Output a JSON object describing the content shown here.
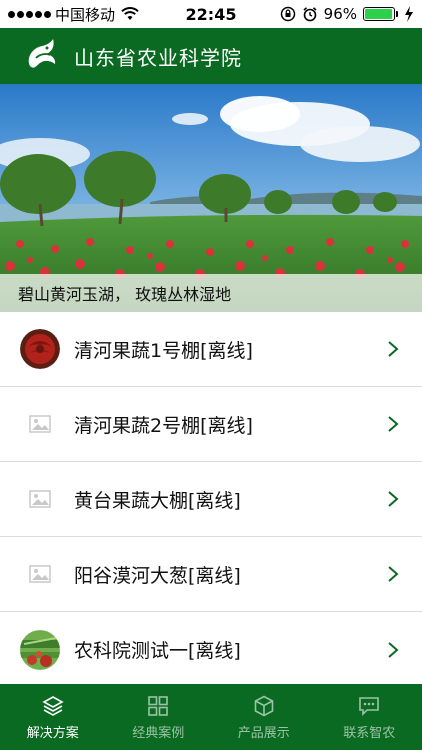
{
  "status_bar": {
    "carrier": "中国移动",
    "time": "22:45",
    "battery": "96%",
    "battery_level": 0.96
  },
  "header": {
    "title": "山东省农业科学院",
    "logo_icon": "leaf-dragon-logo-icon"
  },
  "banner": {
    "caption": "碧山黄河玉湖， 玫瑰丛林湿地"
  },
  "list": {
    "items": [
      {
        "label": "清河果蔬1号棚[离线]",
        "thumb": "rose-photo"
      },
      {
        "label": "清河果蔬2号棚[离线]",
        "thumb": "image-placeholder-icon"
      },
      {
        "label": "黄台果蔬大棚[离线]",
        "thumb": "image-placeholder-icon"
      },
      {
        "label": "阳谷漠河大葱[离线]",
        "thumb": "image-placeholder-icon"
      },
      {
        "label": "农科院测试一[离线]",
        "thumb": "vegetables-photo"
      }
    ]
  },
  "tabs": [
    {
      "label": "解决方案",
      "icon": "layers-icon",
      "active": true
    },
    {
      "label": "经典案例",
      "icon": "grid-icon",
      "active": false
    },
    {
      "label": "产品展示",
      "icon": "cube-icon",
      "active": false
    },
    {
      "label": "联系智农",
      "icon": "chat-icon",
      "active": false
    }
  ],
  "colors": {
    "brand_green": "#0a6a22",
    "tab_inactive": "#9cc3a7",
    "battery_green": "#2bd14b"
  }
}
